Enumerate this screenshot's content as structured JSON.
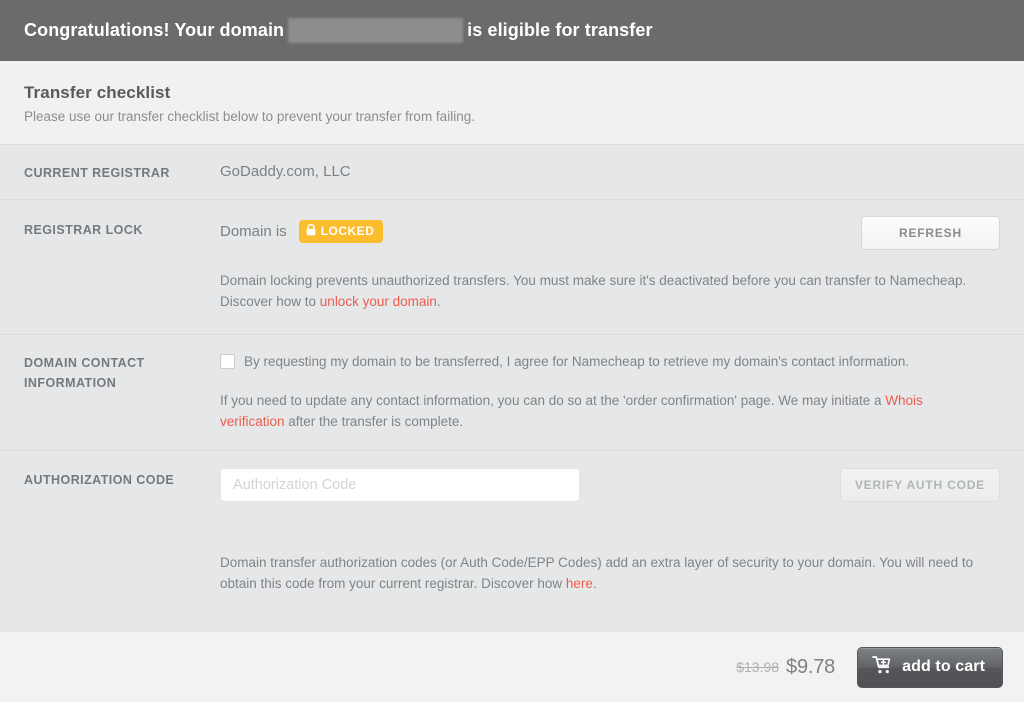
{
  "banner": {
    "text_before": "Congratulations! Your domain",
    "domain_redacted": "",
    "text_after": "is eligible for transfer",
    "background_color": "#6b6b6b"
  },
  "intro": {
    "title": "Transfer checklist",
    "subtitle": "Please use our transfer checklist below to prevent your transfer from failing."
  },
  "rows": {
    "registrar": {
      "label": "CURRENT REGISTRAR",
      "value": "GoDaddy.com, LLC"
    },
    "lock": {
      "label": "REGISTRAR LOCK",
      "prefix": "Domain is",
      "badge_label": "LOCKED",
      "badge_icon": "lock-icon",
      "badge_color": "#fbbc2d",
      "refresh_label": "REFRESH",
      "description_part1": "Domain locking prevents unauthorized transfers. You must make sure it's deactivated before you can transfer to Namecheap. Discover how to ",
      "description_link": "unlock your domain",
      "description_part2": "."
    },
    "contact": {
      "label": "DOMAIN CONTACT INFORMATION",
      "checkbox_checked": false,
      "checkbox_label": "By requesting my domain to be transferred, I agree for Namecheap to retrieve my domain's contact information.",
      "description_part1": "If you need to update any contact information, you can do so at the 'order confirmation' page. We may initiate a ",
      "description_link": "Whois verification",
      "description_part2": " after the transfer is complete."
    },
    "auth": {
      "label": "AUTHORIZATION CODE",
      "input_value": "",
      "input_placeholder": "Authorization Code",
      "verify_label": "VERIFY AUTH CODE",
      "description_part1": "Domain transfer authorization codes (or Auth Code/EPP Codes) add an extra layer of security to your domain. You will need to obtain this code from your current registrar. Discover how ",
      "description_link": "here",
      "description_part2": "."
    }
  },
  "footer": {
    "price_old": "$13.98",
    "price_new": "$9.78",
    "cart_label": "add to cart",
    "cart_icon": "shopping-cart-plus-icon"
  },
  "colors": {
    "link": "#ef5c4e",
    "badge": "#fbbc2d",
    "header": "#6b6b6b"
  }
}
